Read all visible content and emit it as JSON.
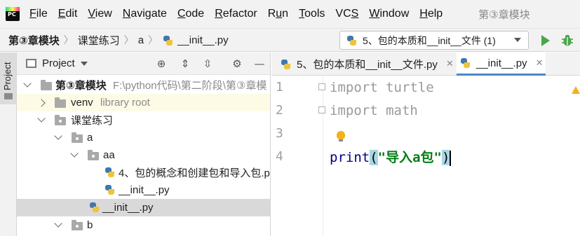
{
  "menubar": {
    "logo_text": "PC",
    "items": [
      {
        "label": "File",
        "mnemonic": "F"
      },
      {
        "label": "Edit",
        "mnemonic": "E"
      },
      {
        "label": "View",
        "mnemonic": "V"
      },
      {
        "label": "Navigate",
        "mnemonic": "N"
      },
      {
        "label": "Code",
        "mnemonic": "C"
      },
      {
        "label": "Refactor",
        "mnemonic": "R"
      },
      {
        "label": "Run",
        "mnemonic": "u"
      },
      {
        "label": "Tools",
        "mnemonic": "T"
      },
      {
        "label": "VCS",
        "mnemonic": "S"
      },
      {
        "label": "Window",
        "mnemonic": "W"
      },
      {
        "label": "Help",
        "mnemonic": "H"
      }
    ],
    "window_title": "第③章模块"
  },
  "navbar": {
    "breadcrumbs": [
      "第③章模块",
      "课堂练习",
      "a",
      "__init__.py"
    ],
    "run_config": "5、包的本质和__init__文件 (1)"
  },
  "toolstrip": {
    "project_tab": "Project"
  },
  "project_panel": {
    "title": "Project",
    "tree": {
      "root": {
        "name": "第③章模块",
        "path": "F:\\python代码\\第二阶段\\第③章模"
      },
      "venv": {
        "name": "venv",
        "note": "library root"
      },
      "practice": "课堂练习",
      "a": "a",
      "aa": "aa",
      "file1": "4、包的概念和创建包和导入包.p",
      "file2": "__init__.py",
      "file3": "__init__.py",
      "b": "b"
    }
  },
  "editor": {
    "tabs": [
      {
        "label": "5、包的本质和__init__文件.py",
        "active": false
      },
      {
        "label": "__init__.py",
        "active": true
      }
    ],
    "close_glyph": "✕",
    "line_numbers": [
      "1",
      "2",
      "3",
      "4"
    ],
    "lines": {
      "l1": {
        "kw": "import",
        "rest": " turtle"
      },
      "l2": {
        "kw": "import",
        "rest": " math"
      },
      "l4": {
        "fn": "print",
        "open": "(",
        "str": "\"导入a包\"",
        "close": ")"
      }
    }
  },
  "colors": {
    "accent": "#4a88c7",
    "run_green": "#4aa54a",
    "string_green": "#067d17",
    "function_navy": "#000080",
    "selection_gray": "#d9d9d9",
    "library_root_bg": "#fdfbe6"
  }
}
